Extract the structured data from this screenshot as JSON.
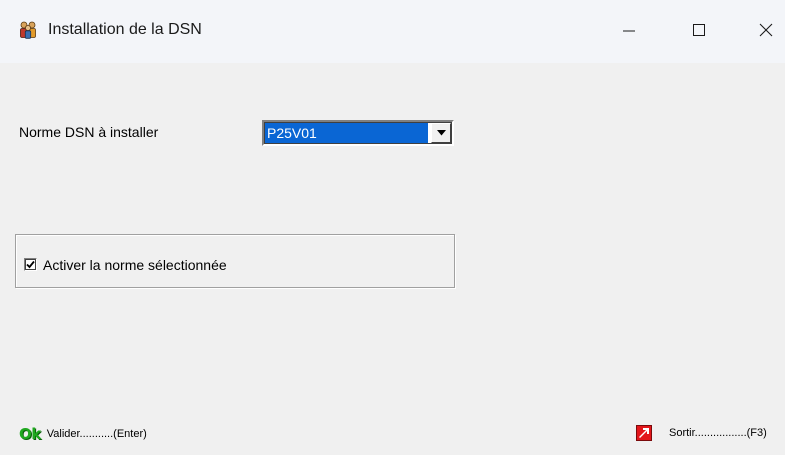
{
  "window": {
    "title": "Installation de la DSN"
  },
  "form": {
    "norme_label": "Norme DSN à installer",
    "norme_selected": "P25V01",
    "activate_label": "Activer la norme sélectionnée",
    "activate_checked": true
  },
  "footer": {
    "ok_icon_text": "Ok",
    "ok_label": "Valider...........(Enter)",
    "exit_label": "Sortir.................(F3)"
  },
  "icons": {
    "app": "app-people-icon",
    "minimize": "minimize-icon",
    "maximize": "maximize-icon",
    "close": "close-icon",
    "dropdown": "chevron-down-icon",
    "checkmark": "checkmark-icon",
    "exit": "exit-arrow-icon"
  },
  "colors": {
    "selection_blue": "#0a66d4",
    "ok_green": "#1fa81f",
    "exit_red": "#e3161b"
  }
}
